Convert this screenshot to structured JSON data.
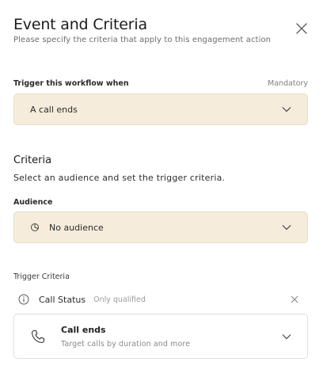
{
  "header": {
    "title": "Event and Criteria",
    "subtitle": "Please specify the criteria that apply to this engagement action"
  },
  "trigger": {
    "label": "Trigger this workflow when",
    "mandatory": "Mandatory",
    "value": "A call ends"
  },
  "criteria": {
    "title": "Criteria",
    "description": "Select an audience and set the trigger criteria."
  },
  "audience": {
    "label": "Audience",
    "value": "No audience"
  },
  "trigger_criteria": {
    "label": "Trigger Criteria",
    "status_name": "Call Status",
    "status_value": "Only qualified",
    "event_title": "Call ends",
    "event_subtitle": "Target calls by duration and more"
  },
  "icons": {
    "close": "close-icon",
    "chevron": "chevron-down-icon",
    "audience": "audience-icon",
    "info": "info-icon",
    "remove": "close-icon",
    "phone": "phone-icon"
  },
  "colors": {
    "select_background": "#f6ecdc",
    "select_border": "#e8dcc6",
    "card_border": "#dedede"
  }
}
